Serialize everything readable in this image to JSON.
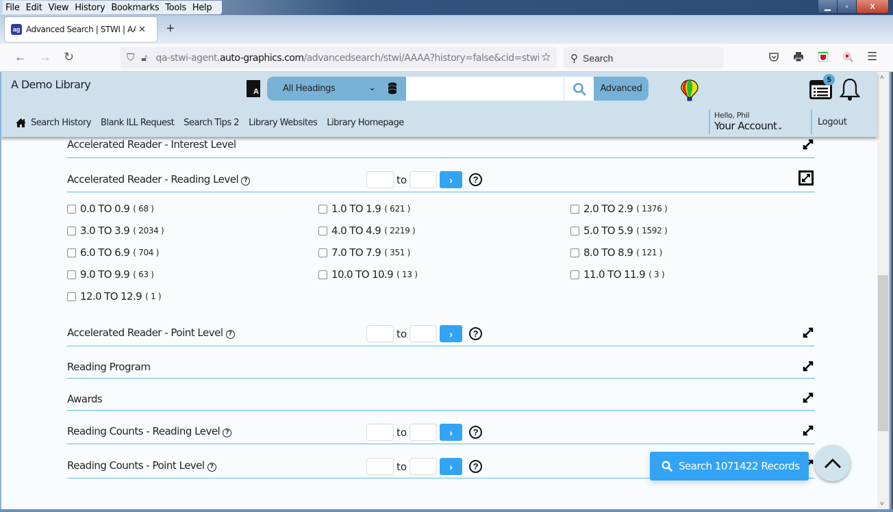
{
  "browser": {
    "menu": [
      "File",
      "Edit",
      "View",
      "History",
      "Bookmarks",
      "Tools",
      "Help"
    ],
    "tab_title": "Advanced Search | STWI | AAAA",
    "tab_favicon": "ag",
    "url_prefix": "qa-stwi-agent.",
    "url_domain": "auto-graphics.com",
    "url_path": "/advancedsearch/stwi/AAAA?history=false&cid=stwi&lid",
    "search_placeholder": "Search"
  },
  "header": {
    "library_name": "A Demo Library",
    "heading_select": "All Headings",
    "search_value": "",
    "advanced_label": "Advanced",
    "list_badge": "5",
    "greeting": "Hello, Phil",
    "account_label": "Your Account",
    "logout_label": "Logout",
    "nav_links": [
      "Search History",
      "Blank ILL Request",
      "Search Tips 2",
      "Library Websites",
      "Library Homepage"
    ]
  },
  "facets": {
    "interest_level": {
      "label": "Accelerated Reader - Interest Level"
    },
    "ar_reading_level": {
      "label": "Accelerated Reader - Reading Level",
      "to_label": "to",
      "from_value": "",
      "to_value": "",
      "go_label": "›",
      "options": [
        {
          "range": "0.0 TO 0.9",
          "count": "( 68 )"
        },
        {
          "range": "1.0 TO 1.9",
          "count": "( 621 )"
        },
        {
          "range": "2.0 TO 2.9",
          "count": "( 1376 )"
        },
        {
          "range": "3.0 TO 3.9",
          "count": "( 2034 )"
        },
        {
          "range": "4.0 TO 4.9",
          "count": "( 2219 )"
        },
        {
          "range": "5.0 TO 5.9",
          "count": "( 1592 )"
        },
        {
          "range": "6.0 TO 6.9",
          "count": "( 704 )"
        },
        {
          "range": "7.0 TO 7.9",
          "count": "( 351 )"
        },
        {
          "range": "8.0 TO 8.9",
          "count": "( 121 )"
        },
        {
          "range": "9.0 TO 9.9",
          "count": "( 63 )"
        },
        {
          "range": "10.0 TO 10.9",
          "count": "( 13 )"
        },
        {
          "range": "11.0 TO 11.9",
          "count": "( 3 )"
        },
        {
          "range": "12.0 TO 12.9",
          "count": "( 1 )"
        }
      ]
    },
    "ar_point_level": {
      "label": "Accelerated Reader - Point Level",
      "to_label": "to",
      "go_label": "›"
    },
    "reading_program": {
      "label": "Reading Program"
    },
    "awards": {
      "label": "Awards"
    },
    "rc_reading_level": {
      "label": "Reading Counts - Reading Level",
      "to_label": "to",
      "go_label": "›"
    },
    "rc_point_level": {
      "label": "Reading Counts - Point Level",
      "to_label": "to",
      "go_label": "›"
    }
  },
  "actions": {
    "search_records_label": "Search 1071422 Records"
  },
  "colors": {
    "header_bg": "#cde0ec",
    "accent_blue": "#33a4f5",
    "select_blue": "#77b2d6",
    "divider": "#5bbde6"
  }
}
